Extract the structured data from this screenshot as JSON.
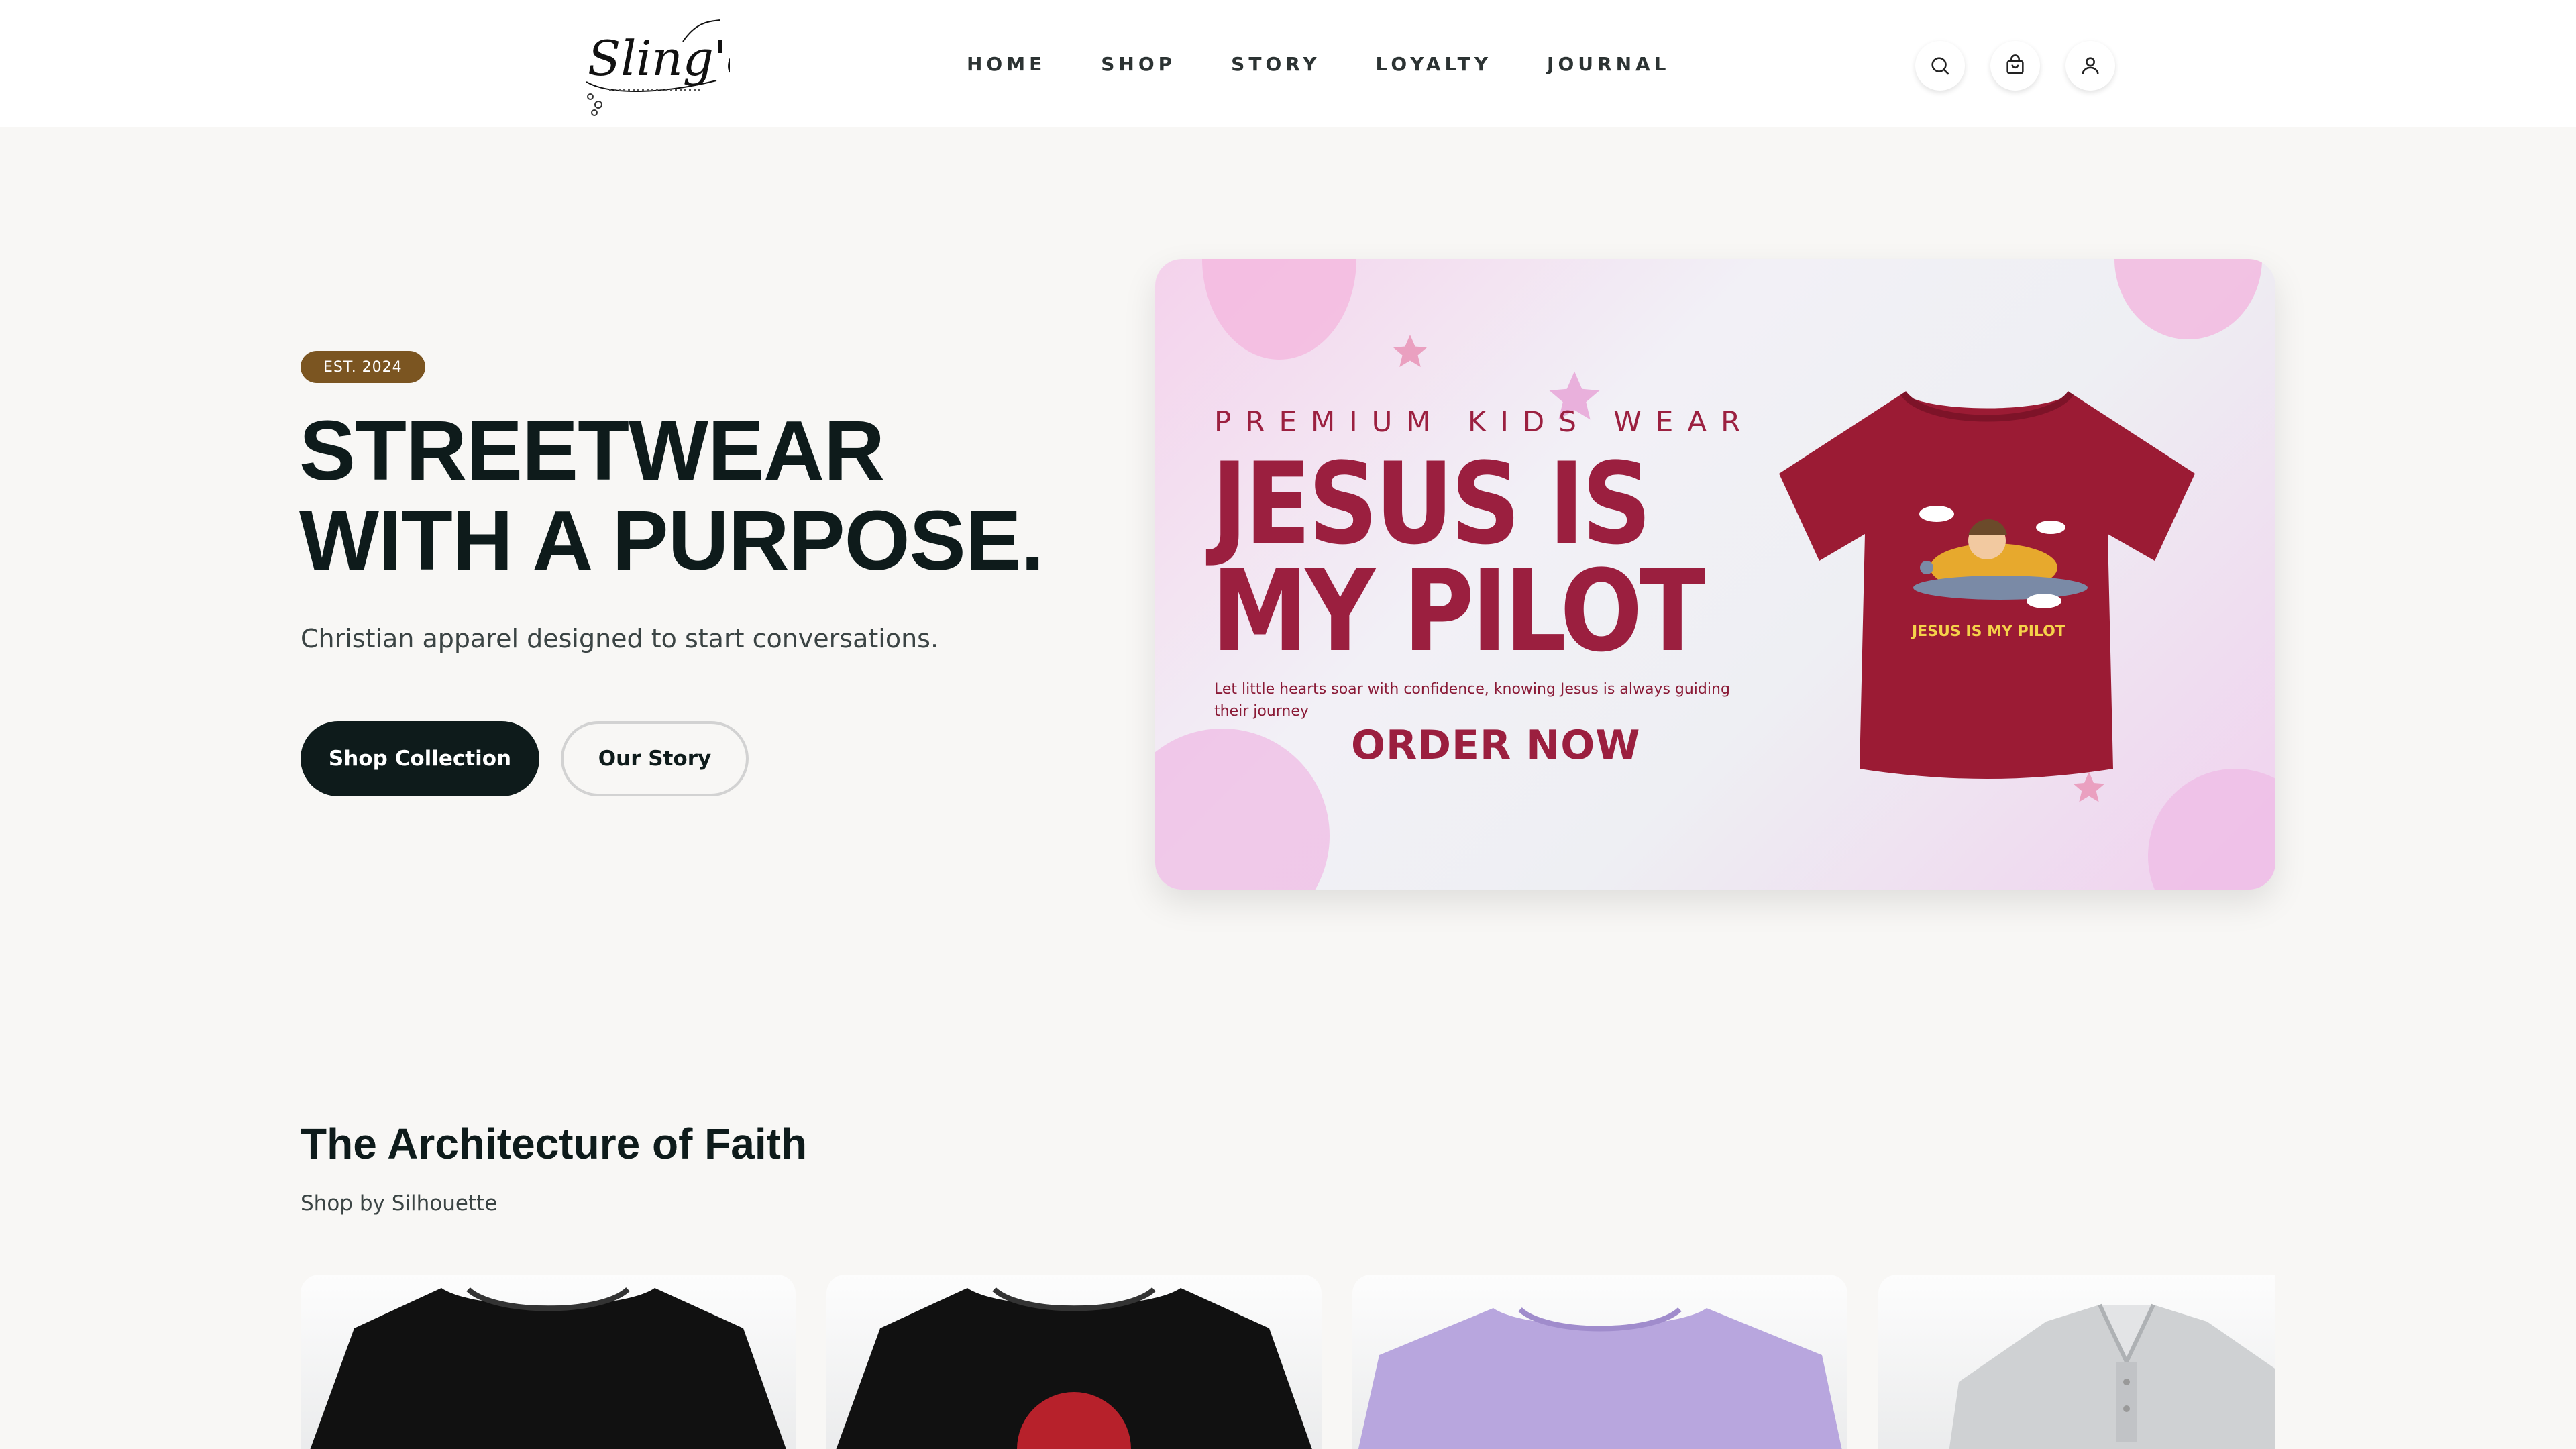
{
  "header": {
    "logo_text": "Sling'd",
    "nav": [
      "HOME",
      "SHOP",
      "STORY",
      "LOYALTY",
      "JOURNAL"
    ],
    "icons": [
      "search-icon",
      "cart-icon",
      "account-icon"
    ]
  },
  "hero": {
    "badge": "EST. 2024",
    "title_line1": "STREETWEAR",
    "title_line2": "WITH A PURPOSE.",
    "subtitle": "Christian apparel designed to start conversations.",
    "primary_button": "Shop Collection",
    "secondary_button": "Our Story"
  },
  "banner": {
    "kicker": "PREMIUM KIDS WEAR",
    "title_line1": "JESUS IS",
    "title_line2": "MY PILOT",
    "body": "Let little hearts soar with confidence, knowing Jesus is always guiding their journey",
    "cta": "ORDER NOW",
    "shirt_print": "JESUS IS MY PILOT",
    "shirt_color": "#9b1b34"
  },
  "collection": {
    "title": "The Architecture of Faith",
    "subtitle": "Shop by Silhouette",
    "cards": [
      {
        "color": "#111111"
      },
      {
        "color": "#111111"
      },
      {
        "color": "#b8a6de"
      },
      {
        "color": "#cfd1d3"
      }
    ]
  },
  "colors": {
    "accent_dark": "#0e1b1b",
    "badge_brown": "#7b5521",
    "banner_red": "#9b1f3f"
  }
}
